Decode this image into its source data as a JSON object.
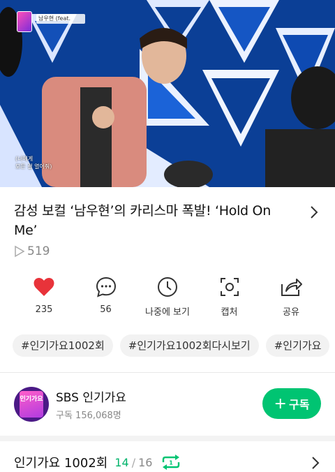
{
  "video": {
    "caption_line1": "(너에게",
    "caption_line2": "모든 걸 열어줘)",
    "song_tag": "남우현 (feat.",
    "logo_text": "인기가요"
  },
  "title": "감성 보컬 ‘남우현’의 카리스마 폭발! ‘Hold On Me’",
  "play_count": "519",
  "actions": [
    {
      "label": "235",
      "icon": "heart-icon"
    },
    {
      "label": "56",
      "icon": "comment-icon"
    },
    {
      "label": "나중에 보기",
      "icon": "clock-icon"
    },
    {
      "label": "캡처",
      "icon": "capture-icon"
    },
    {
      "label": "공유",
      "icon": "share-icon"
    }
  ],
  "tags": [
    "#인기가요1002회",
    "#인기가요1002회다시보기",
    "#인기가요"
  ],
  "channel": {
    "name": "SBS 인기가요",
    "subscribers": "구독 156,068명",
    "subscribe_label": "구독",
    "avatar_text": "인기가요"
  },
  "playlist": {
    "title": "인기가요 1002회",
    "current": "14",
    "separator": "/",
    "total": "16"
  },
  "colors": {
    "accent_green": "#00c472",
    "heart_red": "#e8333a"
  }
}
